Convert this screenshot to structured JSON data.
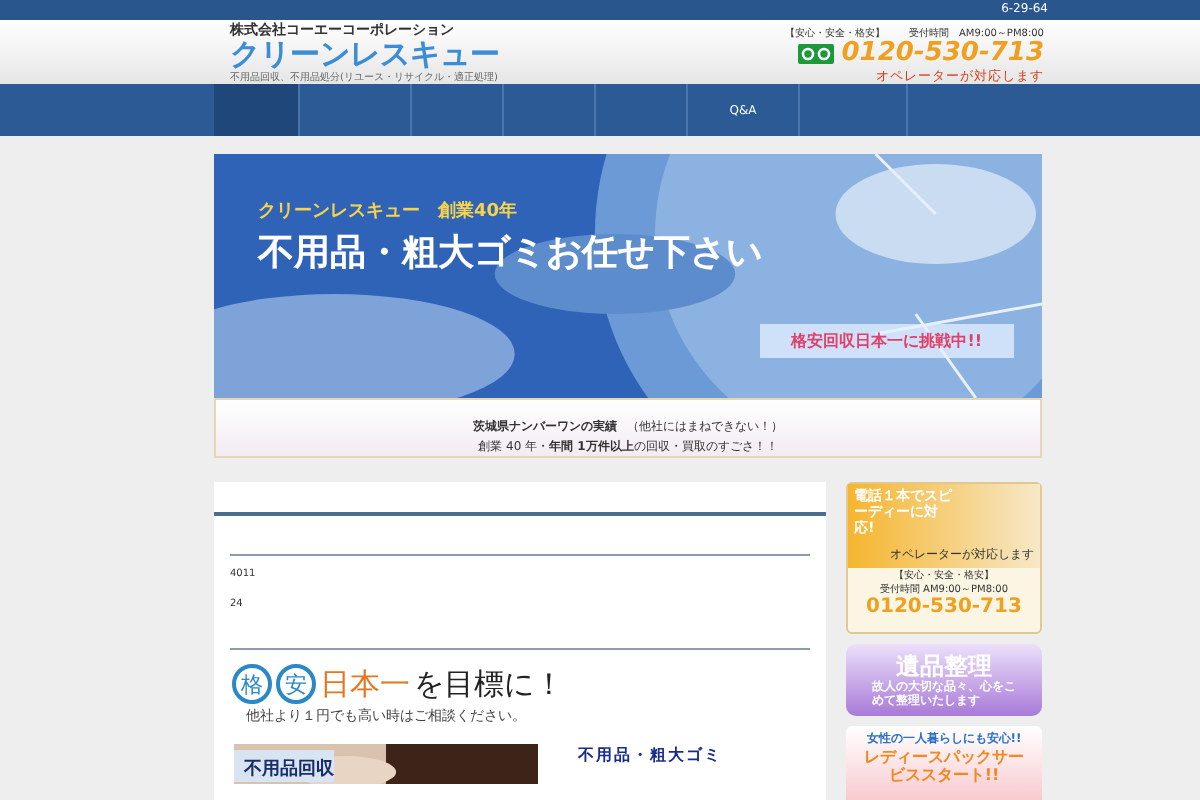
{
  "top_bar": {
    "text": "6-29-64"
  },
  "header": {
    "company": "株式会社コーエーコーポレーション",
    "logo": "クリーンレスキュー",
    "tagline": "不用品回収、不用品処分(リユース・リサイクル・適正処理)",
    "assurance": "【安心・安全・格安】",
    "hours": "受付時間　AM9:00～PM8:00",
    "phone": "0120-530-713",
    "operator_note": "オペレーターが対応します"
  },
  "nav": [
    {
      "selected": true
    },
    {
      "selected": false
    },
    {
      "selected": false
    },
    {
      "selected": false
    },
    {
      "selected": false
    },
    {
      "label": "Q&A",
      "selected": false
    },
    {
      "selected": false
    }
  ],
  "banner": {
    "kicker": "クリーンレスキュー　創業40年",
    "headline": "不用品・粗大ゴミお任せ下さい",
    "challenge": "格安回収日本一に挑戦中!!",
    "strip_line1": "**茨城県**ナンバーワンの実績",
    "strip_note": "（他社にはまねできない！）",
    "strip_line2": "創業 40 年・**年間 1万件以上**の回収・買取のすごさ！！"
  },
  "main": {
    "line_1": "4011",
    "line_2": "24",
    "goal_badges": [
      "格",
      "安"
    ],
    "goal_highlight": "日本一",
    "goal_rest": "を目標に！",
    "goal_sub": "他社より１円でも高い時はご相談ください。",
    "promo_image_text": "不用品回収",
    "promo_heading": "不用品・粗大ゴミ"
  },
  "sidebar": [
    {
      "kind": "phone",
      "title": "電話１本でスピーディーに対応!",
      "operator": "オペレーターが対応します",
      "assurance": "【安心・安全・格安】",
      "hours": "受付時間 AM9:00～PM8:00",
      "phone": "0120-530-713"
    },
    {
      "kind": "estate",
      "title": "遺品整理",
      "text": "故人の大切な品々、心をこめて整理いたします"
    },
    {
      "kind": "ladies",
      "kicker": "女性の一人暮らしにも安心!!",
      "title": "レディースパックサービススタート!!"
    }
  ]
}
